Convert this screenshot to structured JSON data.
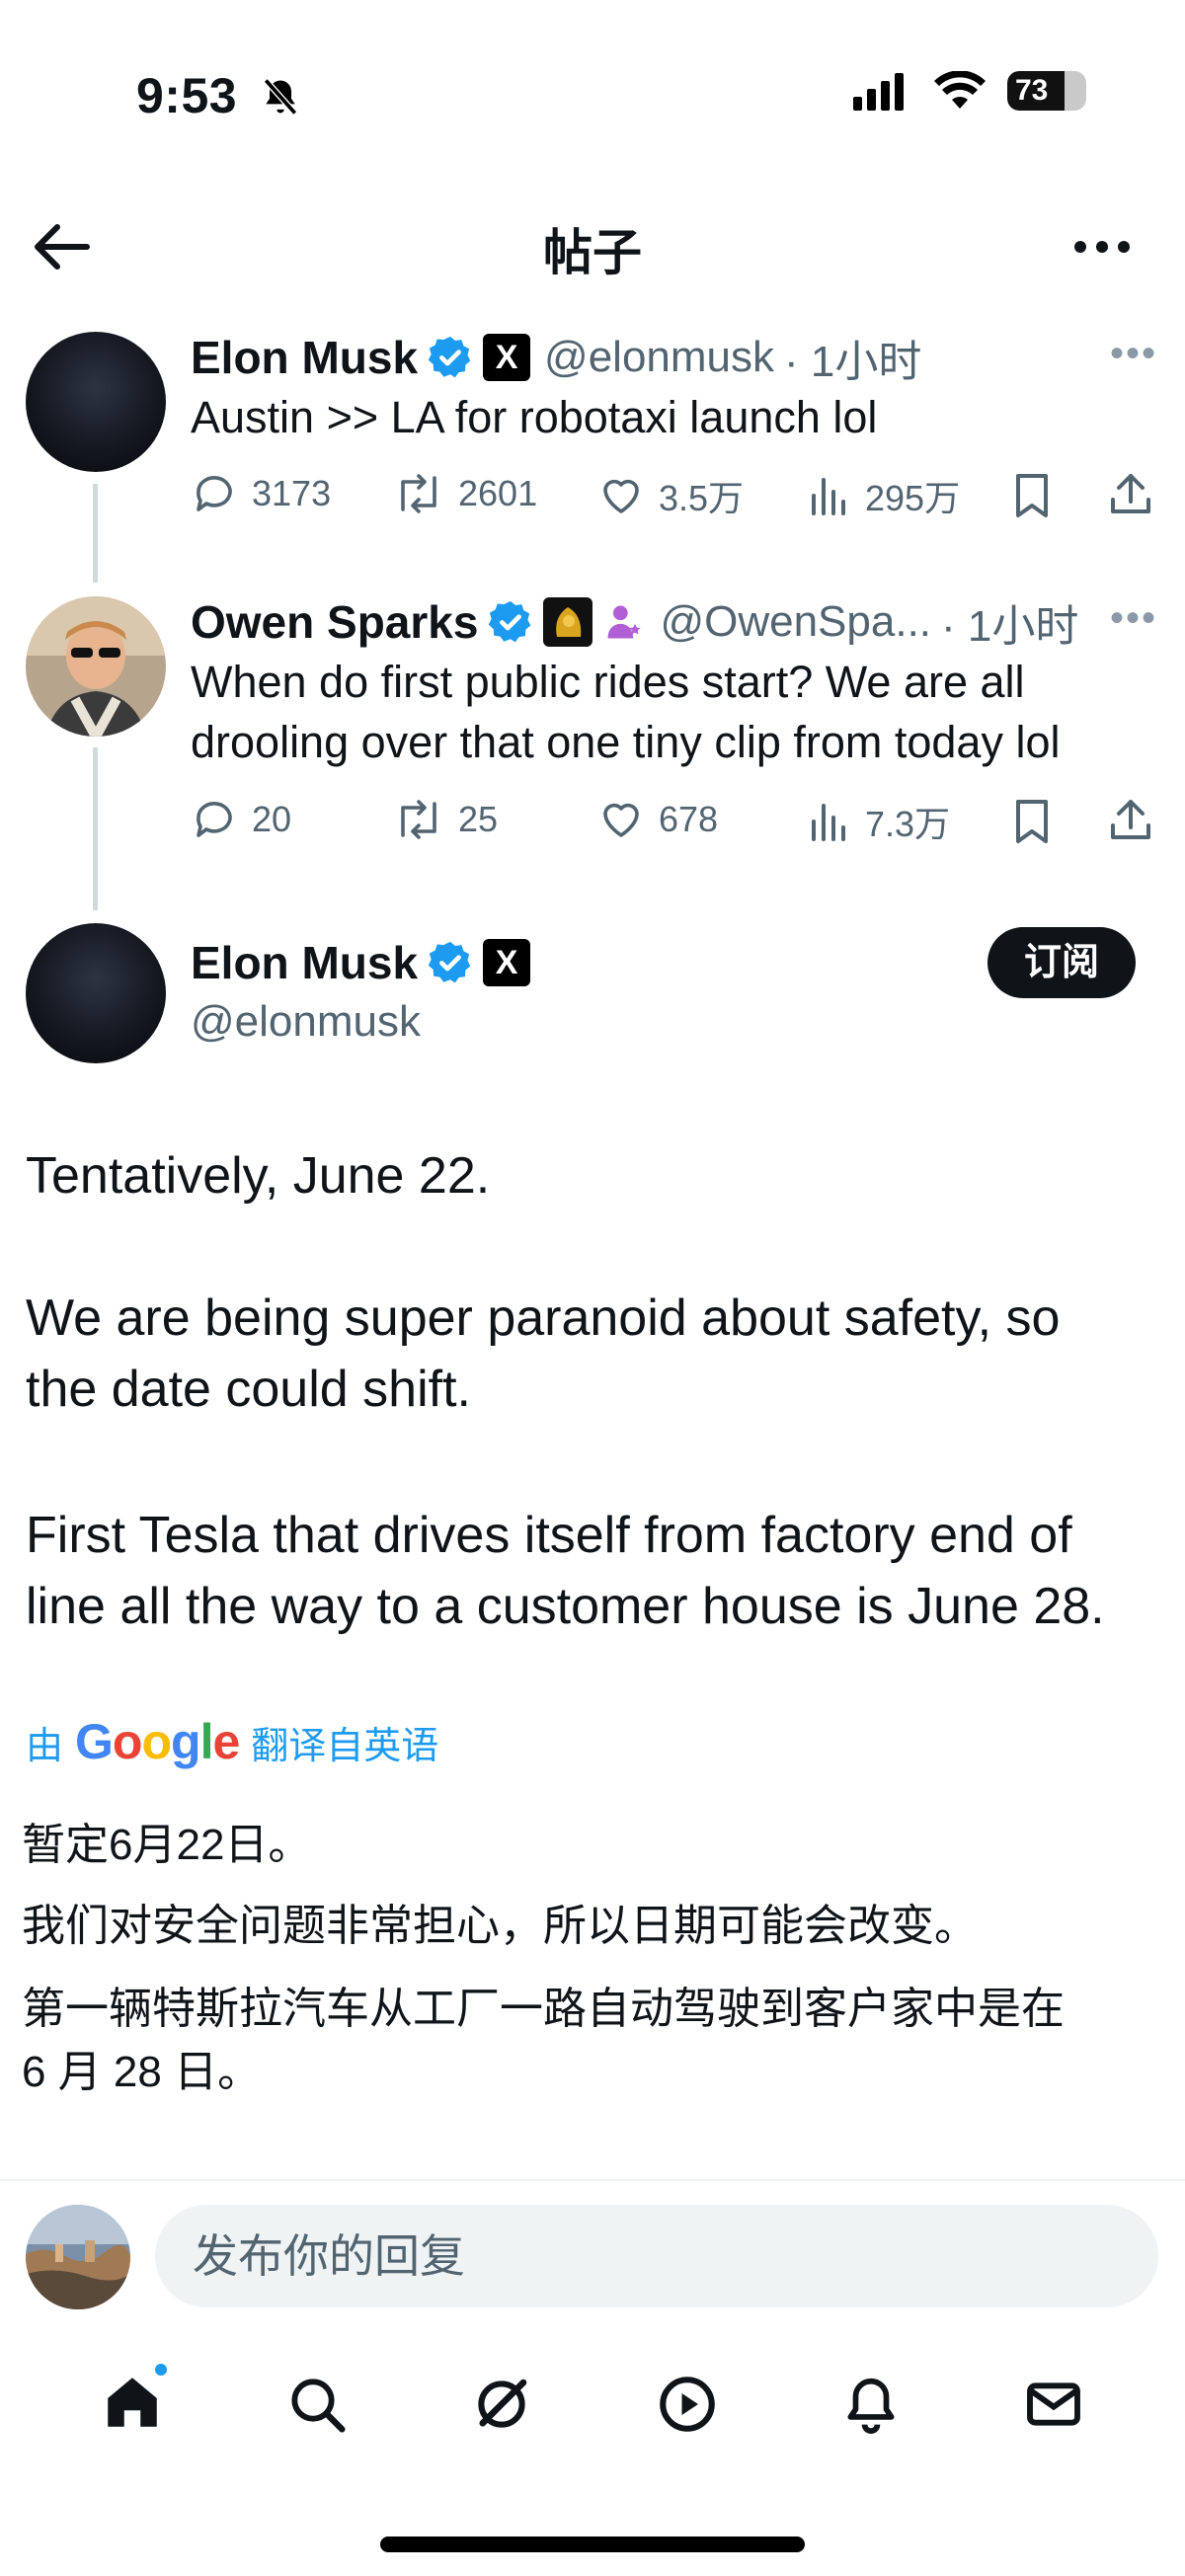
{
  "status_bar": {
    "time": "9:53",
    "battery": "73",
    "battery_level": 0.73
  },
  "header": {
    "title": "帖子"
  },
  "tweet1": {
    "name": "Elon Musk",
    "handle": "@elonmusk",
    "time": "· 1小时",
    "text": "Austin >> LA for robotaxi launch lol",
    "replies": "3173",
    "retweets": "2601",
    "likes": "3.5万",
    "views": "295万"
  },
  "tweet2": {
    "name": "Owen Sparks",
    "handle": "@OwenSpa...",
    "time": "· 1小时",
    "text_line1": "When do first public rides start? We are all",
    "text_line2": "drooling over that one tiny clip from today lol",
    "replies": "20",
    "retweets": "25",
    "likes": "678",
    "views": "7.3万"
  },
  "main_tweet": {
    "name": "Elon Musk",
    "handle": "@elonmusk",
    "subscribe_label": "订阅",
    "para1": "Tentatively, June 22.",
    "para2_line1": "We are being super paranoid about safety, so",
    "para2_line2": "the date could shift.",
    "para3_line1": "First Tesla that drives itself from factory end of",
    "para3_line2": "line all the way to a customer house is June 28.",
    "translate_prefix": "由",
    "translate_brand": "Google",
    "translate_suffix": "翻译自英语",
    "zh_line1": "暂定6月22日。",
    "zh_line2": "我们对安全问题非常担心，所以日期可能会改变。",
    "zh_line3": "第一辆特斯拉汽车从工厂一路自动驾驶到客户家中是在",
    "zh_line4": "6 月 28 日。"
  },
  "reply": {
    "placeholder": "发布你的回复"
  },
  "colors": {
    "accent": "#1d9bf0",
    "verified": "#1d9bf0",
    "text": "#0f1419",
    "muted": "#536471"
  },
  "nav": [
    "home-icon",
    "search-icon",
    "grok-icon",
    "video-icon",
    "notifications-icon",
    "messages-icon"
  ]
}
